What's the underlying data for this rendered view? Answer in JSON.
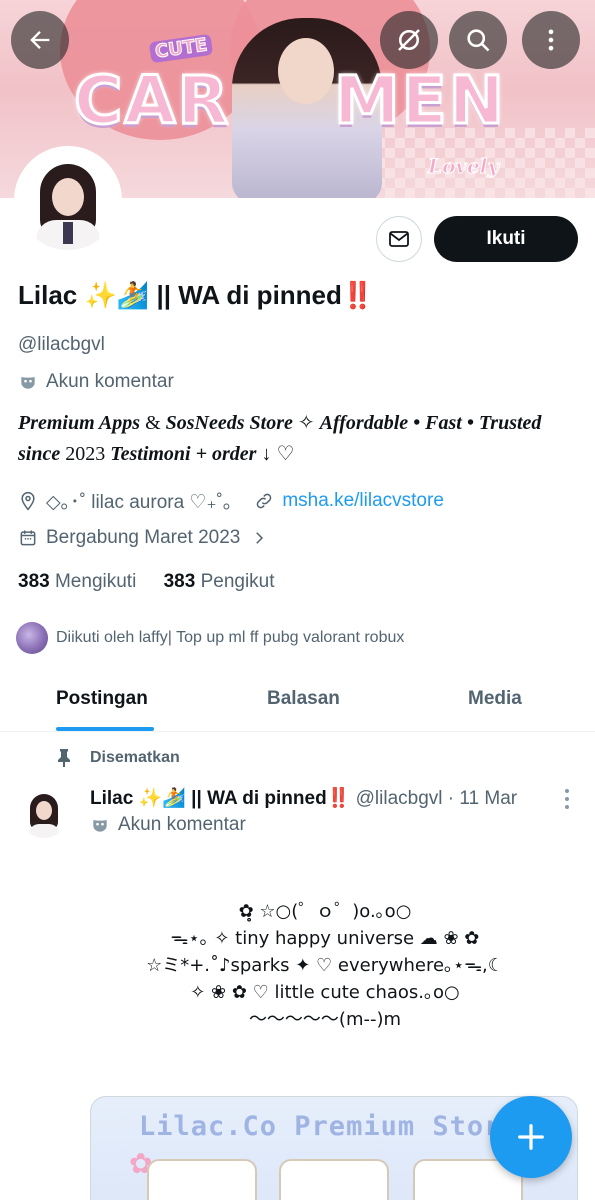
{
  "banner": {
    "cute_text": "CUTE",
    "title_left": "CAR",
    "title_right": "MEN",
    "lovely_text": "Lovely"
  },
  "profile": {
    "follow_label": "Ikuti",
    "name": "Lilac ✨🏄 || WA di pinned‼️",
    "handle": "@lilacbgvl",
    "automated_label": "Akun komentar",
    "bio_1": "Premium Apps",
    "bio_2": " & ",
    "bio_3": "SosNeeds Store",
    "bio_4": " ✧ ",
    "bio_5": "Affordable • Fast • Trusted",
    "bio_6": "since",
    "bio_7": " 2023 ",
    "bio_8": "Testimoni + order",
    "bio_9": " ↓ ♡",
    "location": "◇｡･˚ lilac aurora ♡₊˚｡",
    "link": "msha.ke/lilacvstore",
    "joined": "Bergabung Maret 2023",
    "following_count": "383",
    "following_label": "Mengikuti",
    "followers_count": "383",
    "followers_label": "Pengikut",
    "followed_by": "Diikuti oleh laffy| Top up ml ff pubg valorant robux"
  },
  "tabs": [
    "Postingan",
    "Balasan",
    "Media"
  ],
  "post": {
    "pinned_label": "Disematkan",
    "author": "Lilac ✨🏄 || WA di pinned‼️",
    "meta": " @lilacbgvl · 11 Mar",
    "automated_label": "Akun komentar",
    "lines": [
      "✿̥̥ ☆○(゜ｏ゜)o.｡o○",
      "ᯓ⋆｡ ✧ tiny happy universe ☁︎ ❀ ✿",
      "☆ミ*+.˚♪sparks ✦ ♡ everywhere｡⋆ᯓ,☾",
      "✧ ❀ ✿ ♡ little cute chaos.｡o○",
      "～～～～～(m--)m"
    ],
    "image_title": "Lilac.Co Premium Store"
  },
  "colors": {
    "accent": "#1d9bf0",
    "text": "#0f1419",
    "muted": "#536471"
  },
  "icons": [
    "back-arrow-icon",
    "hide-icon",
    "search-icon",
    "more-vertical-icon",
    "mail-icon",
    "robot-icon",
    "location-icon",
    "link-icon",
    "calendar-icon",
    "chevron-right-icon",
    "pin-icon",
    "plus-icon"
  ]
}
